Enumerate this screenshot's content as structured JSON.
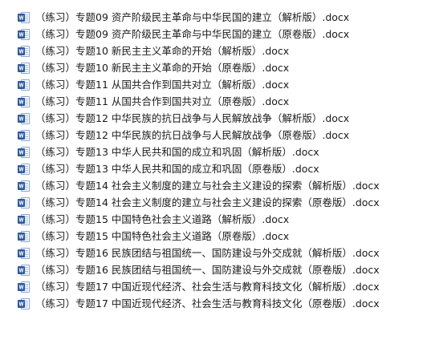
{
  "file_list": {
    "icon": "word-document-icon",
    "icon_color": "#2b579a",
    "items": [
      {
        "name": "（练习）专题09 资产阶级民主革命与中华民国的建立（解析版）.docx"
      },
      {
        "name": "（练习）专题09 资产阶级民主革命与中华民国的建立（原卷版）.docx"
      },
      {
        "name": "（练习）专题10 新民主主义革命的开始（解析版）.docx"
      },
      {
        "name": "（练习）专题10 新民主主义革命的开始（原卷版）.docx"
      },
      {
        "name": "（练习）专题11 从国共合作到国共对立（解析版）.docx"
      },
      {
        "name": "（练习）专题11 从国共合作到国共对立（原卷版）.docx"
      },
      {
        "name": "（练习）专题12 中华民族的抗日战争与人民解放战争（解析版）.docx"
      },
      {
        "name": "（练习）专题12 中华民族的抗日战争与人民解放战争（原卷版）.docx"
      },
      {
        "name": "（练习）专题13 中华人民共和国的成立和巩固（解析版）.docx"
      },
      {
        "name": "（练习）专题13 中华人民共和国的成立和巩固（原卷版）.docx"
      },
      {
        "name": "（练习）专题14 社会主义制度的建立与社会主义建设的探索（解析版）.docx"
      },
      {
        "name": "（练习）专题14 社会主义制度的建立与社会主义建设的探索（原卷版）.docx"
      },
      {
        "name": "（练习）专题15 中国特色社会主义道路（解析版）.docx"
      },
      {
        "name": "（练习）专题15 中国特色社会主义道路（原卷版）.docx"
      },
      {
        "name": "（练习）专题16 民族团结与祖国统一、国防建设与外交成就（解析版）.docx"
      },
      {
        "name": "（练习）专题16 民族团结与祖国统一、国防建设与外交成就（原卷版）.docx"
      },
      {
        "name": "（练习）专题17 中国近现代经济、社会生活与教育科技文化（解析版）.docx"
      },
      {
        "name": "（练习）专题17 中国近现代经济、社会生活与教育科技文化（原卷版）.docx"
      }
    ]
  }
}
